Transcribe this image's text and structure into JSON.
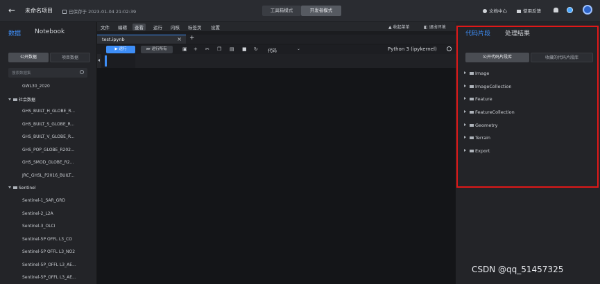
{
  "topbar": {
    "back_glyph": "←",
    "project_name": "未命名项目",
    "saved_text": "已保存于 2023-01-04 21:02:39",
    "mode_tool": "工具箱模式",
    "mode_dev": "开发者模式",
    "doc_center": "文档中心",
    "feedback": "使用反馈",
    "icons": [
      "bell-icon",
      "globe-icon",
      "avatar"
    ]
  },
  "left_panel": {
    "tabs": [
      "数据",
      "Notebook"
    ],
    "active_tab": "数据",
    "buttons": [
      "公开数据",
      "项目数据"
    ],
    "search_placeholder": "搜索数据集",
    "items": [
      {
        "label": "GWL30_2020",
        "kind": "item"
      },
      {
        "label": "社会数据",
        "kind": "group"
      },
      {
        "label": "GHS_BUILT_H_GLOBE_R...",
        "kind": "item"
      },
      {
        "label": "GHS_BUILT_S_GLOBE_R...",
        "kind": "item"
      },
      {
        "label": "GHS_BUILT_V_GLOBE_R...",
        "kind": "item"
      },
      {
        "label": "GHS_POP_GLOBE_R202...",
        "kind": "item"
      },
      {
        "label": "GHS_SMOD_GLOBE_R2...",
        "kind": "item"
      },
      {
        "label": "JRC_GHSL_P2016_BUILT...",
        "kind": "item"
      },
      {
        "label": "Sentinel",
        "kind": "group"
      },
      {
        "label": "Sentinel-1_SAR_GRD",
        "kind": "item"
      },
      {
        "label": "Sentinel-2_L2A",
        "kind": "item"
      },
      {
        "label": "Sentinel-3_OLCI",
        "kind": "item"
      },
      {
        "label": "Sentinel-5P OFFL L3_CO",
        "kind": "item"
      },
      {
        "label": "Sentinel-5P OFFL L3_NO2",
        "kind": "item"
      },
      {
        "label": "Sentinel-5P_OFFL L3_AE...",
        "kind": "item"
      },
      {
        "label": "Sentinel-5P_OFFL L3_AE...",
        "kind": "item"
      }
    ]
  },
  "notebook": {
    "menu": [
      "文件",
      "编辑",
      "查看",
      "运行",
      "内核",
      "标签页",
      "设置"
    ],
    "active_menu": "查看",
    "collapse_menu": "收起菜单",
    "exit_env": "退出环境",
    "tab_name": "test.ipynb",
    "run_label": "▶ 运行",
    "run_all_label": "▸▸ 运行所有",
    "cell_type": "代码",
    "kernel": "Python 3 (ipykernel)"
  },
  "right_panel": {
    "tabs": [
      "代码片段",
      "处理结果"
    ],
    "active_tab": "代码片段",
    "buttons": [
      "公开代码片段库",
      "收藏的代码片段库"
    ],
    "items": [
      "Image",
      "ImageCollection",
      "Feature",
      "FeatureCollection",
      "Geometry",
      "Terrain",
      "Export"
    ],
    "highlight_color": "#e01818"
  },
  "watermark": "CSDN @qq_51457325",
  "colors": {
    "accent": "#3e8ef7",
    "background": "#1b1c1f",
    "panel": "#232428"
  }
}
